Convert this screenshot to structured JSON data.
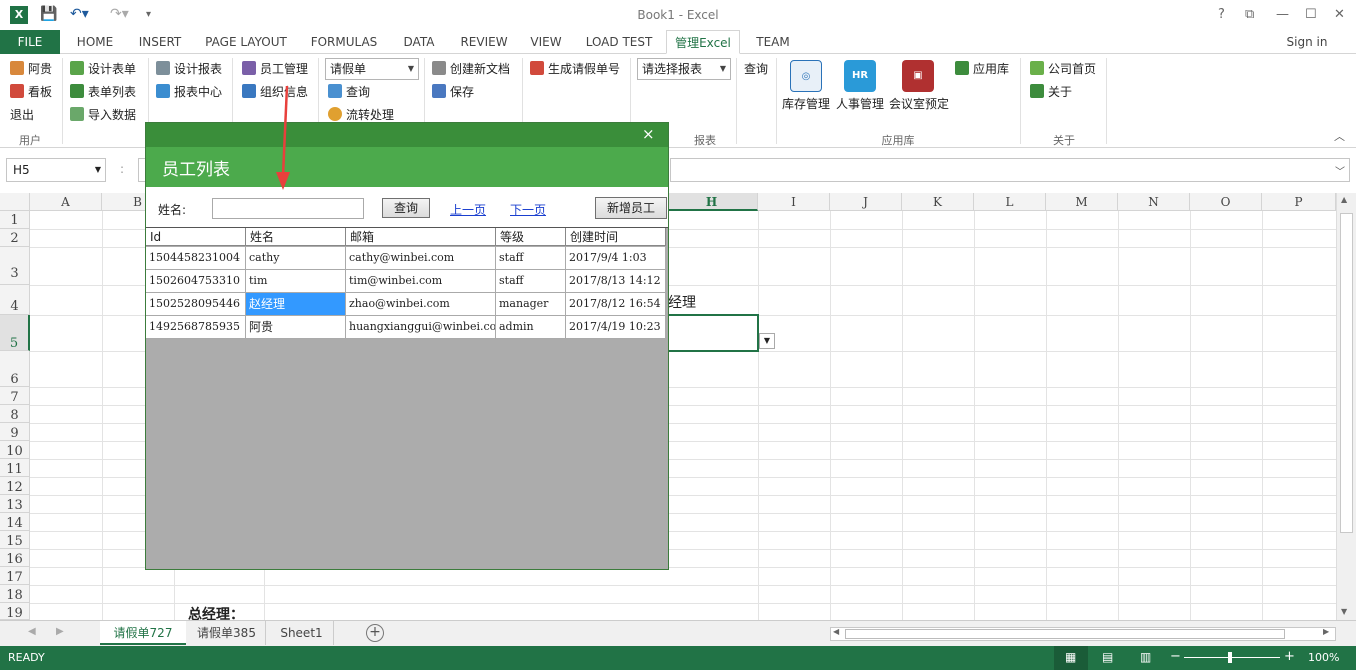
{
  "window": {
    "title": "Book1 - Excel",
    "logo": "X",
    "sign_in": "Sign in"
  },
  "tabs": [
    "FILE",
    "HOME",
    "INSERT",
    "PAGE LAYOUT",
    "FORMULAS",
    "DATA",
    "REVIEW",
    "VIEW",
    "LOAD TEST",
    "管理Excel",
    "TEAM"
  ],
  "ribbon": {
    "user": {
      "name": "阿贵",
      "board": "看板",
      "logout": "退出",
      "group": "用户"
    },
    "forms": {
      "design_form": "设计表单",
      "form_list": "表单列表",
      "import_data": "导入数据"
    },
    "reports": {
      "design_report": "设计报表",
      "report_center": "报表中心"
    },
    "org": {
      "employee_mgmt": "员工管理",
      "org_info": "组织信息"
    },
    "flow": {
      "select_value": "请假单",
      "query": "查询",
      "process": "流转处理"
    },
    "doc": {
      "create_doc": "创建新文档",
      "save": "保存"
    },
    "gen": {
      "generate": "生成请假单号"
    },
    "report_grp": {
      "select_placeholder": "请选择报表",
      "query": "查询",
      "group": "报表"
    },
    "apps": {
      "inventory": "库存管理",
      "hr": "人事管理",
      "meeting": "会议室预定",
      "app_store": "应用库",
      "group": "应用库",
      "hr_icon_text": "HR"
    },
    "about": {
      "company_home": "公司首页",
      "about": "关于",
      "group": "关于"
    }
  },
  "formula_bar": {
    "name_box": "H5",
    "fx_sep": ":"
  },
  "grid": {
    "columns": [
      "A",
      "B",
      "",
      "",
      "",
      "",
      "",
      "H",
      "I",
      "J",
      "K",
      "L",
      "M",
      "N",
      "O",
      "P"
    ],
    "rows": [
      "1",
      "2",
      "3",
      "4",
      "5",
      "6",
      "7",
      "8",
      "9",
      "10",
      "11",
      "12",
      "13",
      "14",
      "15",
      "16",
      "17",
      "18",
      "19"
    ],
    "cell_g4": "经理",
    "cell_bottom": "总经理："
  },
  "sheets": [
    "请假单727",
    "请假单385",
    "Sheet1"
  ],
  "status": {
    "ready": "READY",
    "zoom": "100%"
  },
  "dialog": {
    "title": "员工列表",
    "close": "×",
    "name_label": "姓名:",
    "name_value": "",
    "query_btn": "查询",
    "prev": "上一页",
    "next": "下一页",
    "add_btn": "新增员工",
    "headers": [
      "Id",
      "姓名",
      "邮箱",
      "等级",
      "创建时间"
    ],
    "rows": [
      [
        "1504458231004",
        "cathy",
        "cathy@winbei.com",
        "staff",
        "2017/9/4 1:03"
      ],
      [
        "1502604753310",
        "tim",
        "tim@winbei.com",
        "staff",
        "2017/8/13 14:12"
      ],
      [
        "1502528095446",
        "赵经理",
        "zhao@winbei.com",
        "manager",
        "2017/8/12 16:54"
      ],
      [
        "1492568785935",
        "阿贵",
        "huangxianggui@winbei.com",
        "admin",
        "2017/4/19 10:23"
      ]
    ]
  },
  "colors": {
    "excel_green": "#217346",
    "dialog_green": "#4caa4c",
    "arrow_red": "#e8403c",
    "highlight": "#3399ff"
  }
}
